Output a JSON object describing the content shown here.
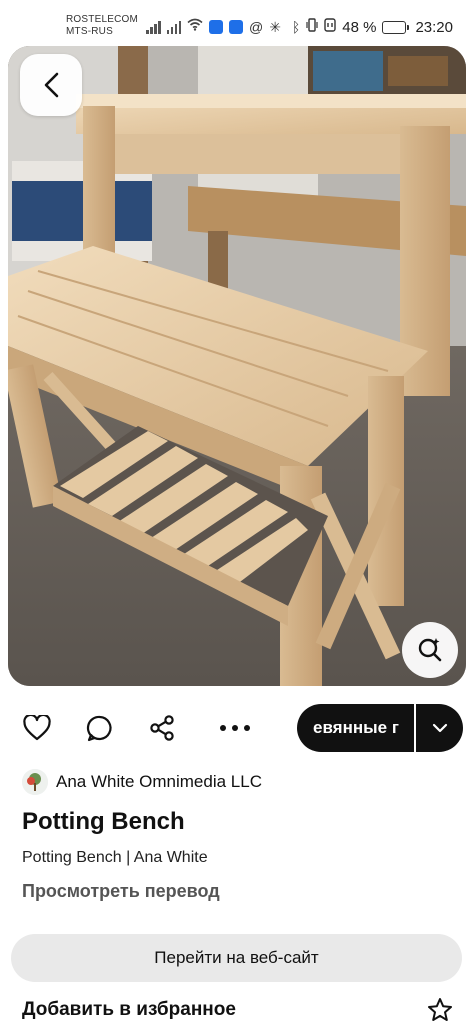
{
  "status_bar": {
    "carrier_line1": "ROSTELECOM",
    "carrier_line2": "MTS-RUS",
    "battery_text": "48 %",
    "battery_level": 0.48,
    "time": "23:20"
  },
  "hero": {
    "description_icon": "potting-bench-photo",
    "back_icon": "chevron-left-icon",
    "lens_icon": "visual-search-icon"
  },
  "actions": {
    "like_icon": "heart-icon",
    "comment_icon": "speech-bubble-icon",
    "share_icon": "share-icon",
    "more_icon": "more-horizontal-icon",
    "board_label": "евянные г",
    "dropdown_icon": "chevron-down-icon"
  },
  "pin": {
    "author": "Ana White Omnimedia LLC",
    "title": "Potting Bench",
    "subtitle": "Potting Bench | Ana White",
    "translate_label": "Просмотреть перевод",
    "visit_button": "Перейти на веб-сайт",
    "favorite_label": "Добавить в избранное",
    "favorite_icon": "star-outline-icon"
  },
  "colors": {
    "accent_dark": "#111111",
    "secondary_button": "#e9e9e9",
    "muted_text": "#555555"
  }
}
